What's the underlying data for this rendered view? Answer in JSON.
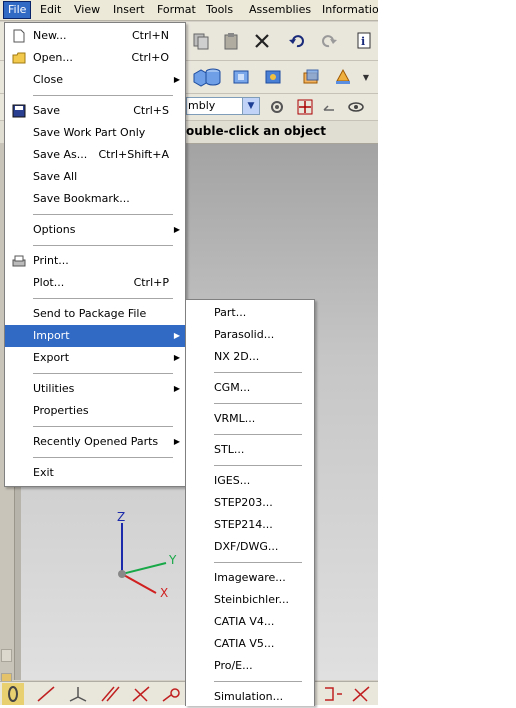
{
  "menubar": {
    "items": [
      "File",
      "Edit",
      "View",
      "Insert",
      "Format",
      "Tools",
      "Assemblies",
      "Informatio"
    ]
  },
  "toolbar": {
    "filter_value": "mbly"
  },
  "cue_line": {
    "text": "ouble-click an object"
  },
  "triad": {
    "z": "Z",
    "y": "Y",
    "x": "X"
  },
  "file_menu": {
    "new": {
      "label": "New...",
      "shortcut": "Ctrl+N"
    },
    "open": {
      "label": "Open...",
      "shortcut": "Ctrl+O"
    },
    "close": {
      "label": "Close"
    },
    "save": {
      "label": "Save",
      "shortcut": "Ctrl+S"
    },
    "save_work_part_only": {
      "label": "Save Work Part Only"
    },
    "save_as": {
      "label": "Save As...",
      "shortcut": "Ctrl+Shift+A"
    },
    "save_all": {
      "label": "Save All"
    },
    "save_bookmark": {
      "label": "Save Bookmark..."
    },
    "options": {
      "label": "Options"
    },
    "print": {
      "label": "Print..."
    },
    "plot": {
      "label": "Plot...",
      "shortcut": "Ctrl+P"
    },
    "send_to_package": {
      "label": "Send to Package File"
    },
    "import": {
      "label": "Import"
    },
    "export": {
      "label": "Export"
    },
    "utilities": {
      "label": "Utilities"
    },
    "properties": {
      "label": "Properties"
    },
    "recently_opened": {
      "label": "Recently Opened Parts"
    },
    "exit": {
      "label": "Exit"
    }
  },
  "import_menu": {
    "items": [
      "Part...",
      "Parasolid...",
      "NX 2D...",
      "CGM...",
      "VRML...",
      "STL...",
      "IGES...",
      "STEP203...",
      "STEP214...",
      "DXF/DWG...",
      "Imageware...",
      "Steinbichler...",
      "CATIA V4...",
      "CATIA V5...",
      "Pro/E...",
      "Simulation..."
    ]
  },
  "colors": {
    "highlight": "#316ac5",
    "menu_bg": "#ffffff",
    "toolbar_bg": "#e9e6dc"
  }
}
